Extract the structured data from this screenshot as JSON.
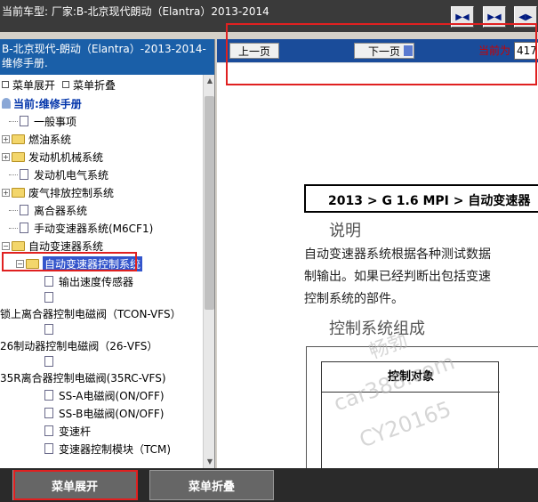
{
  "window": {
    "title": "当前车型:  厂家:B-北京现代朗动（Elantra）2013-2014"
  },
  "toolbar": {
    "buttons": [
      "▶◀",
      "▶◀",
      "◀▶"
    ]
  },
  "left_panel": {
    "header": "B-北京现代-朗动（Elantra）-2013-2014- 维修手册.",
    "expand_all": "菜单展开",
    "collapse_all": "菜单折叠",
    "current": "当前:维修手册",
    "tree": [
      {
        "label": "一般事项",
        "type": "doc"
      },
      {
        "label": "燃油系统",
        "type": "folder"
      },
      {
        "label": "发动机机械系统",
        "type": "folder"
      },
      {
        "label": "发动机电气系统",
        "type": "doc"
      },
      {
        "label": "废气排放控制系统",
        "type": "folder"
      },
      {
        "label": "离合器系统",
        "type": "doc"
      },
      {
        "label": "手动变速器系统(M6CF1)",
        "type": "doc"
      },
      {
        "label": "自动变速器系统",
        "type": "folder"
      },
      {
        "label": "自动变速器控制系统",
        "type": "folder"
      },
      {
        "label": "输出速度传感器",
        "type": "doc"
      },
      {
        "label": "锁上离合器控制电磁阀（TCON-VFS）",
        "type": "doc"
      },
      {
        "label": "26制动器控制电磁阀（26-VFS）",
        "type": "doc"
      },
      {
        "label": "35R离合器控制电磁阀(35RC-VFS)",
        "type": "doc"
      },
      {
        "label": "SS-A电磁阀(ON/OFF)",
        "type": "doc"
      },
      {
        "label": "SS-B电磁阀(ON/OFF)",
        "type": "doc"
      },
      {
        "label": "变速杆",
        "type": "doc"
      },
      {
        "label": "变速器控制模块（TCM)",
        "type": "doc"
      }
    ]
  },
  "viewer": {
    "prev_label": "上一页",
    "next_label": "下一页",
    "current_page_label": "当前为",
    "page_number": "417",
    "doc": {
      "path": "2013 > G 1.6 MPI > 自动变速器",
      "heading1": "说明",
      "paragraph": [
        "自动变速器系统根据各种测试数据",
        "制输出。如果已经判断出包括变速",
        "控制系统的部件。"
      ],
      "heading2": "控制系统组成",
      "table_header": "控制对象"
    },
    "watermarks": [
      "畅勃",
      "car388.com",
      "CY20165"
    ]
  },
  "bottom": {
    "expand_label": "菜单展开",
    "collapse_label": "菜单折叠"
  }
}
